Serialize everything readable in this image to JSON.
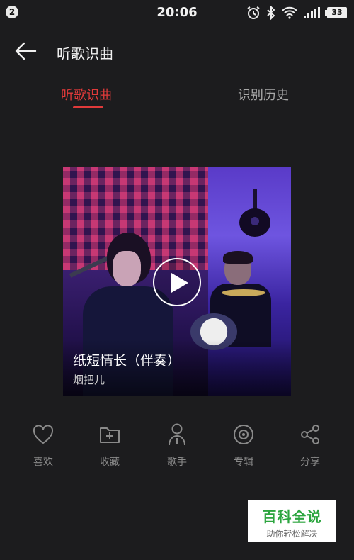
{
  "status_bar": {
    "notification_count": "2",
    "time": "20:06",
    "icons": [
      "alarm-icon",
      "bluetooth-icon",
      "wifi-icon",
      "signal-icon",
      "battery-icon"
    ],
    "battery": "33"
  },
  "app_bar": {
    "back_icon": "arrow-left-icon",
    "title": "听歌识曲"
  },
  "tabs": [
    {
      "label": "听歌识曲",
      "active": true
    },
    {
      "label": "识别历史",
      "active": false
    }
  ],
  "song": {
    "title": "纸短情长（伴奏）",
    "artist": "烟把儿"
  },
  "actions": [
    {
      "label": "喜欢",
      "icon": "heart-icon"
    },
    {
      "label": "收藏",
      "icon": "folder-add-icon"
    },
    {
      "label": "歌手",
      "icon": "singer-icon"
    },
    {
      "label": "专辑",
      "icon": "disc-icon"
    },
    {
      "label": "分享",
      "icon": "share-icon"
    }
  ],
  "watermark": {
    "main": "百科全说",
    "sub": "助你轻松解决"
  },
  "colors": {
    "accent": "#e03a3a",
    "background": "#1c1c1e",
    "inactive_text": "#a8a8a8",
    "watermark_green": "#2ca53f"
  }
}
